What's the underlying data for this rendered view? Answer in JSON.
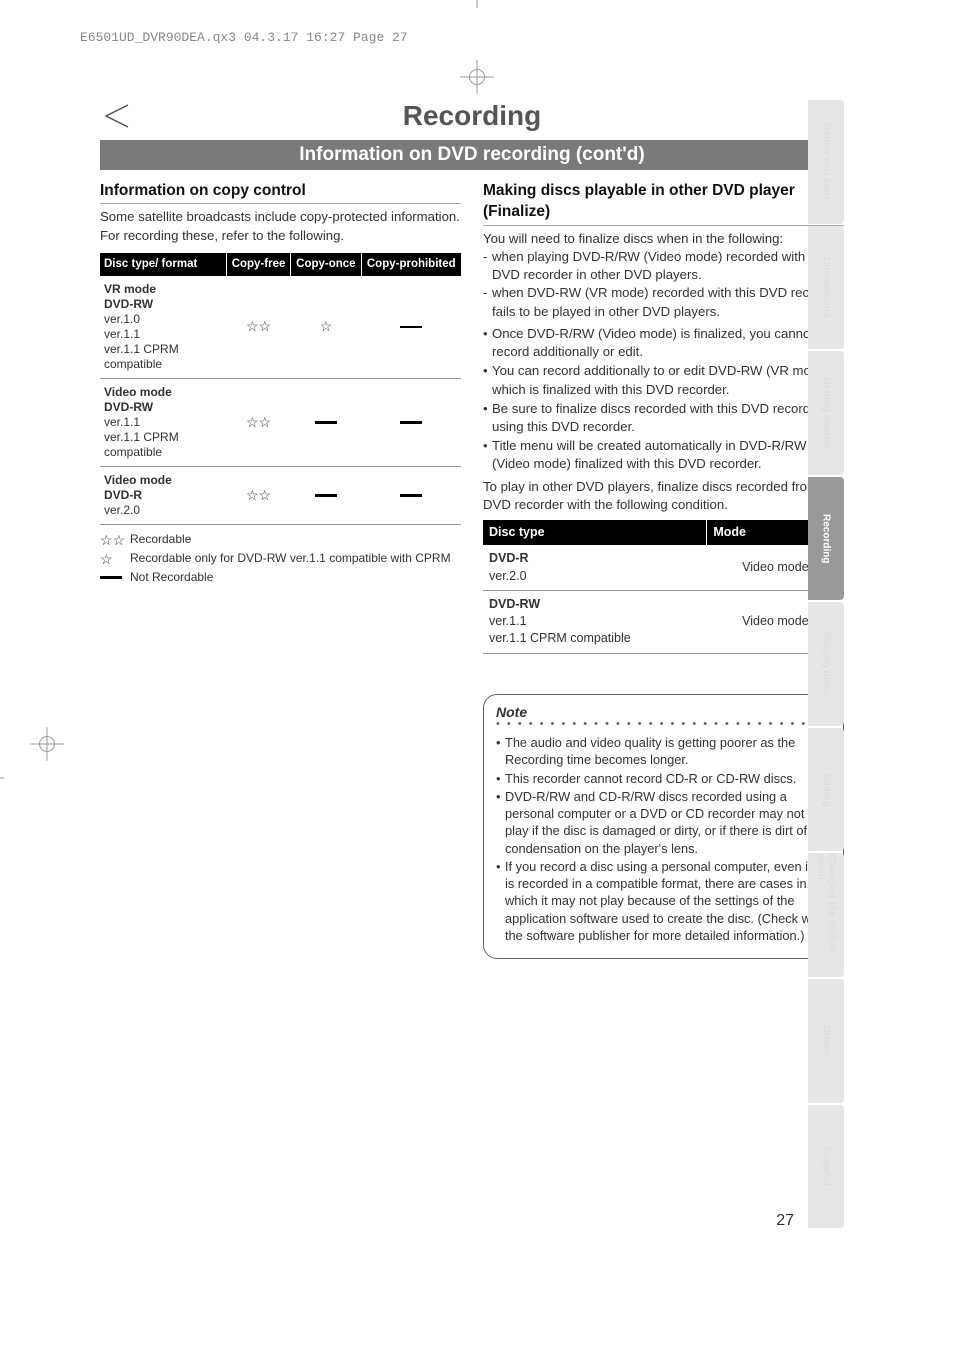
{
  "print_header": "E6501UD_DVR90DEA.qx3  04.3.17  16:27  Page 27",
  "page_title": "Recording",
  "section_bar": "Information on DVD recording (cont'd)",
  "left": {
    "heading": "Information on copy control",
    "intro": "Some satellite broadcasts include copy-protected information. For recording these, refer to the following.",
    "table": {
      "headers": [
        "Disc type/ format",
        "Copy-free",
        "Copy-once",
        "Copy-prohibited"
      ],
      "rows": [
        {
          "label_bold": "VR mode\nDVD-RW",
          "label_rest": "ver.1.0\nver.1.1\nver.1.1 CPRM compatible",
          "copy_free": "☆☆",
          "copy_once": "☆",
          "copy_prohibited": "—"
        },
        {
          "label_bold": "Video mode\nDVD-RW",
          "label_rest": "ver.1.1\nver.1.1 CPRM compatible",
          "copy_free": "☆☆",
          "copy_once": "—",
          "copy_prohibited": "—"
        },
        {
          "label_bold": "Video mode\nDVD-R",
          "label_rest": "ver.2.0",
          "copy_free": "☆☆",
          "copy_once": "—",
          "copy_prohibited": "—"
        }
      ]
    },
    "legend": {
      "rec2": {
        "sym": "☆☆",
        "text": "Recordable"
      },
      "rec1": {
        "sym": "☆",
        "text": "Recordable only for DVD-RW ver.1.1 compatible with CPRM"
      },
      "not": {
        "sym": "—",
        "text": "Not Recordable"
      }
    }
  },
  "right": {
    "heading": "Making discs playable in other DVD player (Finalize)",
    "intro": "You will need to finalize discs when in the following:",
    "dashed": [
      "when playing DVD-R/RW (Video mode) recorded with this DVD recorder in other DVD players.",
      "when DVD-RW (VR mode) recorded with this DVD recorder fails to be played in other DVD players."
    ],
    "bullets": [
      "Once DVD-R/RW (Video mode) is finalized, you cannot record additionally or edit.",
      "You can record additionally to or edit DVD-RW (VR mode), which is finalized with this DVD recorder.",
      "Be sure to finalize discs recorded with this DVD recorder by using this DVD recorder.",
      "Title menu will be created automatically in DVD-R/RW (Video mode) finalized with this DVD recorder."
    ],
    "after": "To play in other DVD players, finalize discs recorded from this DVD recorder with the following condition.",
    "mode_table": {
      "headers": [
        "Disc type",
        "Mode"
      ],
      "rows": [
        {
          "type_bold": "DVD-R",
          "type_rest": "ver.2.0",
          "mode": "Video mode"
        },
        {
          "type_bold": "DVD-RW",
          "type_rest": "ver.1.1\nver.1.1 CPRM compatible",
          "mode": "Video mode"
        }
      ]
    },
    "note": {
      "title": "Note",
      "items": [
        "The audio and video quality is getting poorer as the Recording time becomes longer.",
        "This recorder cannot record CD-R or CD-RW discs.",
        "DVD-R/RW and CD-R/RW discs recorded using a personal computer or a DVD or CD recorder may not play if the disc is damaged or dirty, or if there is dirt of condensation on the player's lens.",
        "If you record a disc using a personal computer, even if it is recorded in a compatible format, there are cases in which it may not play because of the settings of the application software used to create the disc. (Check with the software publisher for more detailed information.)"
      ]
    }
  },
  "side_tabs": [
    {
      "label": "Before you start",
      "active": false
    },
    {
      "label": "Connections",
      "active": false
    },
    {
      "label": "Getting started",
      "active": false
    },
    {
      "label": "Recording",
      "active": true
    },
    {
      "label": "Playing discs",
      "active": false
    },
    {
      "label": "Editing",
      "active": false
    },
    {
      "label": "Changing the SETUP menu",
      "active": false
    },
    {
      "label": "Others",
      "active": false
    },
    {
      "label": "Español",
      "active": false
    }
  ],
  "page_number": "27"
}
